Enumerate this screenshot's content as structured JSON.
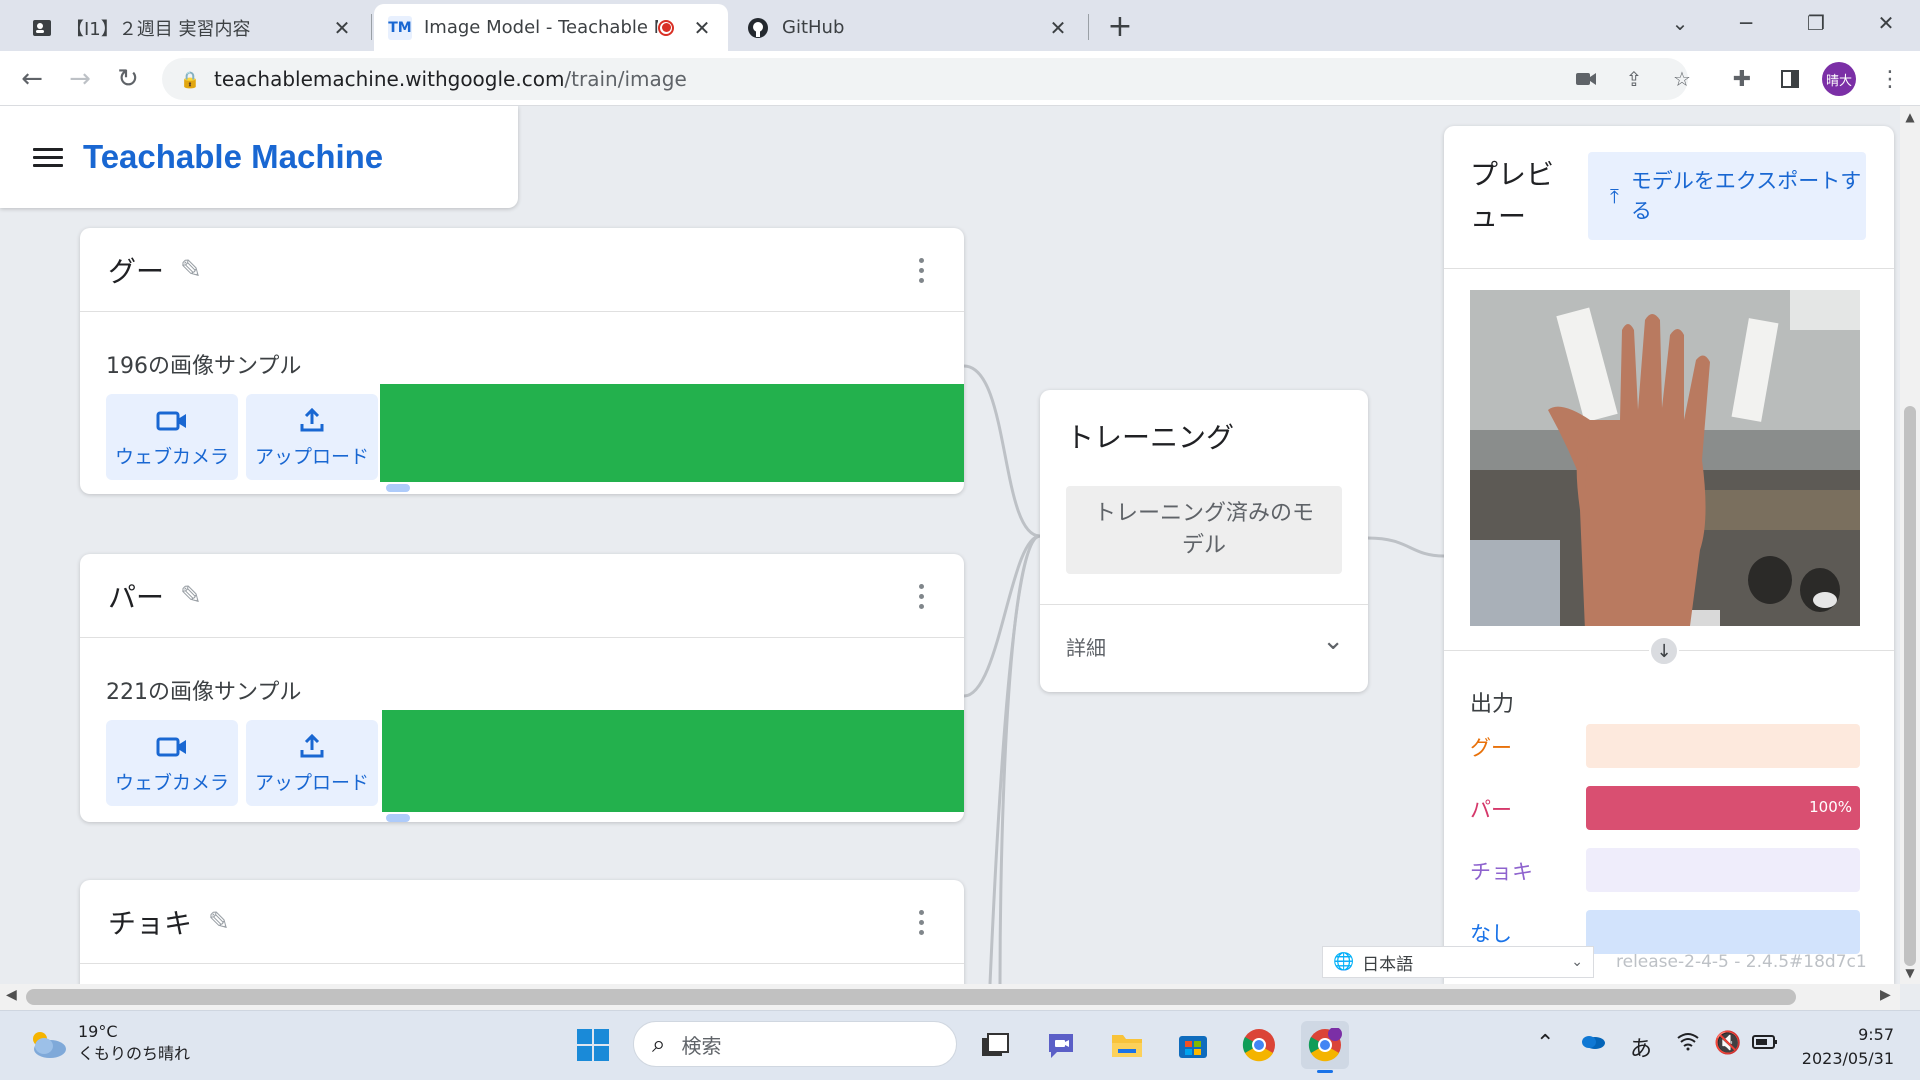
{
  "browser": {
    "tabs": [
      {
        "title": "【I1】２週目 実習内容",
        "favicon": "person-card-icon"
      },
      {
        "title": "Image Model - Teachable Ma",
        "favicon": "TM",
        "recording": true
      },
      {
        "title": "GitHub",
        "favicon": "github-icon"
      }
    ],
    "new_tab_label": "+",
    "url_host": "teachablemachine.withgoogle.com",
    "url_path": "/train/image",
    "profile_initials": "晴大"
  },
  "app": {
    "brand": "Teachable Machine",
    "classes": [
      {
        "name": "グー",
        "samples": "196の画像サンプル",
        "webcam_label": "ウェブカメラ",
        "upload_label": "アップロード"
      },
      {
        "name": "パー",
        "samples": "221の画像サンプル",
        "webcam_label": "ウェブカメラ",
        "upload_label": "アップロード"
      },
      {
        "name": "チョキ"
      }
    ],
    "training": {
      "title": "トレーニング",
      "button": "トレーニング済みのモデル",
      "details": "詳細"
    },
    "preview": {
      "title": "プレビュー",
      "export_button": "モデルをエクスポートする",
      "output_title": "出力",
      "outputs": [
        {
          "label": "グー",
          "value": 0,
          "color": "#e8710a",
          "bg": "#fde9dd",
          "pct_text": ""
        },
        {
          "label": "パー",
          "value": 1.0,
          "color": "#d5386a",
          "bg": "#d94f71",
          "pct_text": "100%"
        },
        {
          "label": "チョキ",
          "value": 0,
          "color": "#8e63ce",
          "bg": "#efedfb",
          "pct_text": ""
        },
        {
          "label": "なし",
          "value": 0,
          "color": "#1a73e8",
          "bg": "#d2e3fc",
          "pct_text": ""
        }
      ]
    },
    "language": "日本語",
    "release": "release-2-4-5 - 2.4.5#18d7c1"
  },
  "taskbar": {
    "weather_temp": "19°C",
    "weather_desc": "くもりのち晴れ",
    "search_placeholder": "検索",
    "ime": "あ",
    "time": "9:57",
    "date": "2023/05/31"
  }
}
